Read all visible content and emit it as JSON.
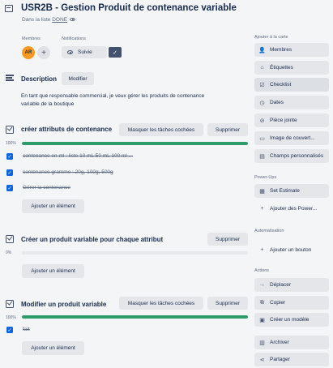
{
  "card": {
    "title": "USR2B - Gestion Produit de contenance variable",
    "list_prefix": "Dans la liste ",
    "list_name": "DONE"
  },
  "members": {
    "label": "Membres",
    "avatar_initials": "AR",
    "add_symbol": "+"
  },
  "notifications": {
    "label": "Notifications",
    "watch_label": "Suivie",
    "check_symbol": "✓"
  },
  "description": {
    "title": "Description",
    "edit_label": "Modifier",
    "text": "En tant que responsable commercial, je veux gérer les produits de contenance variable de la boutique"
  },
  "checklists": [
    {
      "title": "créer attributs de contenance",
      "hide_label": "Masquer les tâches cochées",
      "delete_label": "Supprimer",
      "progress_label": "100%",
      "progress": 1.0,
      "items": [
        {
          "text": " contenance en ml : liste 10 mL 50 mL 100 ml ...",
          "checked": true
        },
        {
          "text": " contenance gramme : 20g, 100g, 500g",
          "checked": true
        },
        {
          "text": "Gérer la contenance",
          "checked": true
        }
      ],
      "add_label": "Ajouter un élément"
    },
    {
      "title": "Créer un produit variable pour chaque attribut",
      "delete_label": "Supprimer",
      "progress_label": "0%",
      "progress": 0.0,
      "items": [],
      "add_label": "Ajouter un élément"
    },
    {
      "title": "Modifier un produit variable",
      "hide_label": "Masquer les tâches cochées",
      "delete_label": "Supprimer",
      "progress_label": "100%",
      "progress": 1.0,
      "items": [
        {
          "text": "fait",
          "checked": true
        }
      ],
      "add_label": "Ajouter un élément"
    }
  ],
  "sidebar": {
    "add_heading": "Ajouter à la carte",
    "add_items": [
      {
        "label": "Membres",
        "icon": "person-icon"
      },
      {
        "label": "Étiquettes",
        "icon": "tag-icon"
      },
      {
        "label": "Checklist",
        "icon": "checklist-icon"
      },
      {
        "label": "Dates",
        "icon": "clock-icon"
      },
      {
        "label": "Pièce jointe",
        "icon": "paperclip-icon"
      },
      {
        "label": "Image de couvert...",
        "icon": "image-icon"
      },
      {
        "label": "Champs personnalisés",
        "icon": "fields-icon"
      }
    ],
    "powerups_heading": "Power-Ups",
    "powerup_items": [
      {
        "label": "Set Estimate",
        "icon": "estimate-icon"
      },
      {
        "label": "Ajouter des Power...",
        "icon": "plus-icon"
      }
    ],
    "automation_heading": "Automatisation",
    "automation_items": [
      {
        "label": "Ajouter un bouton",
        "icon": "plus-icon"
      }
    ],
    "actions_heading": "Actions",
    "action_items": [
      {
        "label": "Déplacer",
        "icon": "arrow-icon"
      },
      {
        "label": "Copier",
        "icon": "copy-icon"
      },
      {
        "label": "Créer un modèle",
        "icon": "template-icon"
      },
      {
        "label": "Archiver",
        "icon": "archive-icon"
      },
      {
        "label": "Partager",
        "icon": "share-icon"
      }
    ]
  },
  "colors": {
    "progress_fill": "#2e9c6a",
    "checkbox": "#0c66e4",
    "avatar": "#ff991f"
  }
}
